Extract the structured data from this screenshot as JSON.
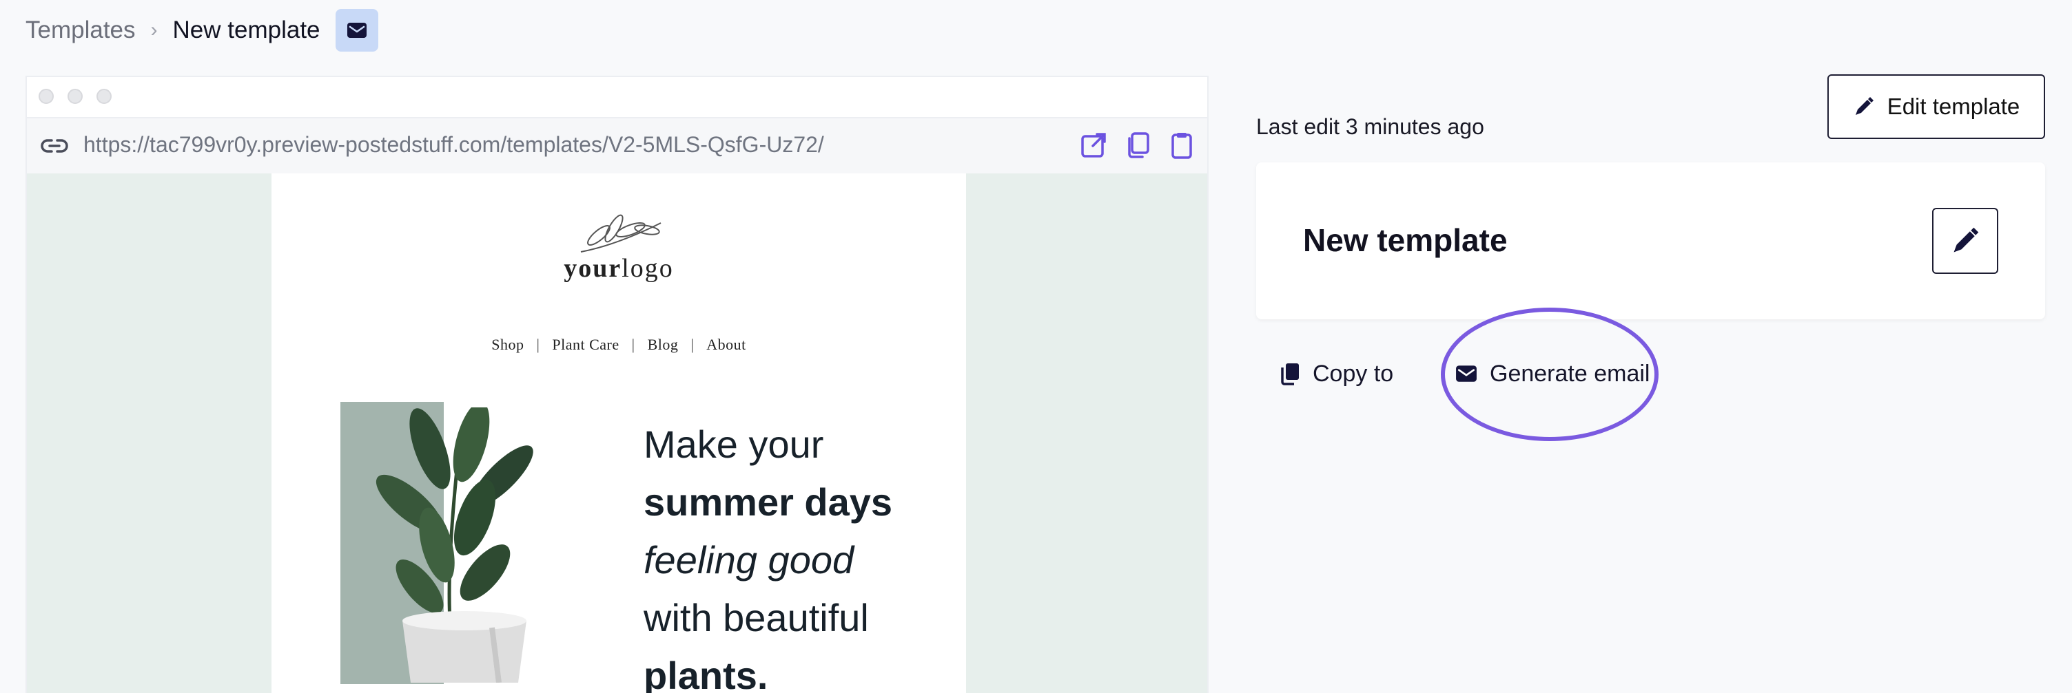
{
  "breadcrumb": {
    "root": "Templates",
    "separator": "›",
    "current": "New template",
    "badge_icon": "mail-icon"
  },
  "browser": {
    "url": "https://tac799vr0y.preview-postedstuff.com/templates/V2-5MLS-QsfG-Uz72/",
    "actions": [
      "open-external-icon",
      "duplicate-icon",
      "clipboard-icon"
    ]
  },
  "email_preview": {
    "logo_part1": "your",
    "logo_part2": "logo",
    "nav": [
      "Shop",
      "Plant Care",
      "Blog",
      "About"
    ],
    "nav_separator": "|",
    "hero": {
      "line1": "Make your",
      "line2": "summer days",
      "line3": "feeling good",
      "line4": "with beautiful",
      "line5": "plants."
    }
  },
  "panel": {
    "edit_template_label": "Edit template",
    "last_edit": "Last edit 3 minutes ago",
    "template_name": "New template",
    "copy_to_label": "Copy to",
    "generate_email_label": "Generate email"
  },
  "colors": {
    "accent": "#7a5ae0",
    "badge_bg": "#c8d9f7",
    "icon_purple": "#6b52e0",
    "preview_bg": "#e7efec"
  }
}
